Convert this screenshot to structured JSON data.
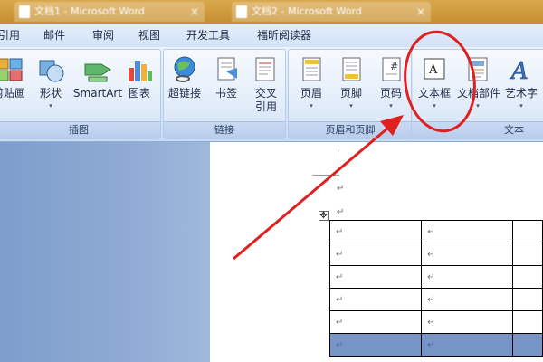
{
  "titlebar": {
    "doc_tabs": [
      {
        "label": "文档1 - Microsoft Word"
      },
      {
        "label": "文档2 - Microsoft Word"
      }
    ],
    "tab_close": "×"
  },
  "ribbon_tabs": [
    "引用",
    "邮件",
    "审阅",
    "视图",
    "开发工具",
    "福昕阅读器"
  ],
  "groups": {
    "illustrations": {
      "label": "插图",
      "buttons": [
        {
          "label": "剪贴画",
          "icon": "clipart-icon",
          "arrow": ""
        },
        {
          "label": "形状",
          "icon": "shapes-icon",
          "arrow": "▾"
        },
        {
          "label": "SmartArt",
          "icon": "smartart-icon",
          "arrow": ""
        },
        {
          "label": "图表",
          "icon": "chart-icon",
          "arrow": ""
        }
      ]
    },
    "links": {
      "label": "链接",
      "buttons": [
        {
          "label": "超链接",
          "icon": "hyperlink-icon"
        },
        {
          "label": "书签",
          "icon": "bookmark-icon"
        },
        {
          "label": "交叉",
          "label2": "引用",
          "icon": "cross-reference-icon"
        }
      ]
    },
    "header_footer": {
      "label": "页眉和页脚",
      "buttons": [
        {
          "label": "页眉",
          "icon": "header-icon",
          "arrow": "▾"
        },
        {
          "label": "页脚",
          "icon": "footer-icon",
          "arrow": "▾"
        },
        {
          "label": "页码",
          "icon": "page-number-icon",
          "arrow": "▾"
        }
      ]
    },
    "text": {
      "label": "文本",
      "buttons": [
        {
          "label": "文本框",
          "icon": "textbox-icon",
          "arrow": "▾"
        },
        {
          "label": "文档部件",
          "icon": "quick-parts-icon",
          "arrow": "▾"
        },
        {
          "label": "艺术字",
          "icon": "wordart-icon",
          "arrow": "▾"
        }
      ]
    }
  },
  "document": {
    "para_mark": "↵",
    "move_handle": "✥",
    "table_rows": 6,
    "table_cols": 3
  },
  "annotation": {
    "color": "#e02020",
    "highlighted": "文本框"
  },
  "colors": {
    "title_bar": "#c58f2f",
    "ribbon": "#dbe7f7",
    "selected_row": "#7895c7"
  }
}
